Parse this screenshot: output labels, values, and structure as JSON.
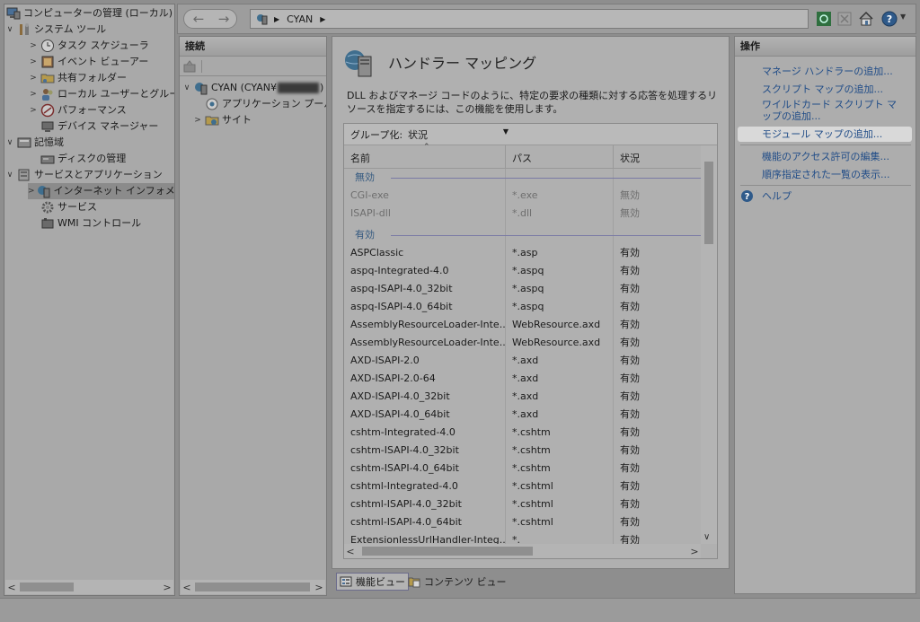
{
  "left_tree": {
    "items": [
      {
        "label": "コンピューターの管理 (ローカル)",
        "icon": "computer-management-icon"
      },
      {
        "label": "システム ツール",
        "icon": "tools-icon"
      },
      {
        "label": "タスク スケジューラ",
        "icon": "clock-icon"
      },
      {
        "label": "イベント ビューアー",
        "icon": "event-viewer-icon"
      },
      {
        "label": "共有フォルダー",
        "icon": "shared-folder-icon"
      },
      {
        "label": "ローカル ユーザーとグループ",
        "icon": "users-icon"
      },
      {
        "label": "パフォーマンス",
        "icon": "performance-icon"
      },
      {
        "label": "デバイス マネージャー",
        "icon": "device-manager-icon"
      },
      {
        "label": "記憶域",
        "icon": "storage-icon"
      },
      {
        "label": "ディスクの管理",
        "icon": "disk-icon"
      },
      {
        "label": "サービスとアプリケーション",
        "icon": "services-apps-icon"
      },
      {
        "label": "インターネット インフォメーシ",
        "icon": "iis-icon"
      },
      {
        "label": "サービス",
        "icon": "gear-icon"
      },
      {
        "label": "WMI コントロール",
        "icon": "wmi-icon"
      }
    ]
  },
  "topbar": {
    "address_text": "CYAN",
    "back_icon": "back-arrow-icon",
    "forward_icon": "forward-arrow-icon"
  },
  "connections": {
    "title": "接続",
    "items": [
      {
        "label": "CYAN (CYAN¥",
        "suffix": ")"
      },
      {
        "label": "アプリケーション プール"
      },
      {
        "label": "サイト"
      }
    ]
  },
  "center": {
    "title": "ハンドラー マッピング",
    "description": "DLL およびマネージ コードのように、特定の要求の種類に対する応答を処理するリソースを指定するには、この機能を使用します。",
    "group_by_label": "グループ化:",
    "group_by_value": "状況",
    "columns": [
      "名前",
      "パス",
      "状況"
    ],
    "groups": [
      {
        "label": "無効",
        "rows": [
          [
            "CGI-exe",
            "*.exe",
            "無効"
          ],
          [
            "ISAPI-dll",
            "*.dll",
            "無効"
          ]
        ]
      },
      {
        "label": "有効",
        "rows": [
          [
            "ASPClassic",
            "*.asp",
            "有効"
          ],
          [
            "aspq-Integrated-4.0",
            "*.aspq",
            "有効"
          ],
          [
            "aspq-ISAPI-4.0_32bit",
            "*.aspq",
            "有効"
          ],
          [
            "aspq-ISAPI-4.0_64bit",
            "*.aspq",
            "有効"
          ],
          [
            "AssemblyResourceLoader-Inte...",
            "WebResource.axd",
            "有効"
          ],
          [
            "AssemblyResourceLoader-Inte...",
            "WebResource.axd",
            "有効"
          ],
          [
            "AXD-ISAPI-2.0",
            "*.axd",
            "有効"
          ],
          [
            "AXD-ISAPI-2.0-64",
            "*.axd",
            "有効"
          ],
          [
            "AXD-ISAPI-4.0_32bit",
            "*.axd",
            "有効"
          ],
          [
            "AXD-ISAPI-4.0_64bit",
            "*.axd",
            "有効"
          ],
          [
            "cshtm-Integrated-4.0",
            "*.cshtm",
            "有効"
          ],
          [
            "cshtm-ISAPI-4.0_32bit",
            "*.cshtm",
            "有効"
          ],
          [
            "cshtm-ISAPI-4.0_64bit",
            "*.cshtm",
            "有効"
          ],
          [
            "cshtml-Integrated-4.0",
            "*.cshtml",
            "有効"
          ],
          [
            "cshtml-ISAPI-4.0_32bit",
            "*.cshtml",
            "有効"
          ],
          [
            "cshtml-ISAPI-4.0_64bit",
            "*.cshtml",
            "有効"
          ],
          [
            "ExtensionlessUrlHandler-Integ...",
            "*.",
            "有効"
          ]
        ]
      }
    ],
    "view_tabs": [
      "機能ビュー",
      "コンテンツ ビュー"
    ]
  },
  "actions": {
    "title": "操作",
    "items": [
      "マネージ ハンドラーの追加...",
      "スクリプト マップの追加...",
      "ワイルドカード スクリプト マップの追加...",
      "モジュール マップの追加...",
      "機能のアクセス許可の編集...",
      "順序指定された一覧の表示...",
      "ヘルプ"
    ]
  }
}
